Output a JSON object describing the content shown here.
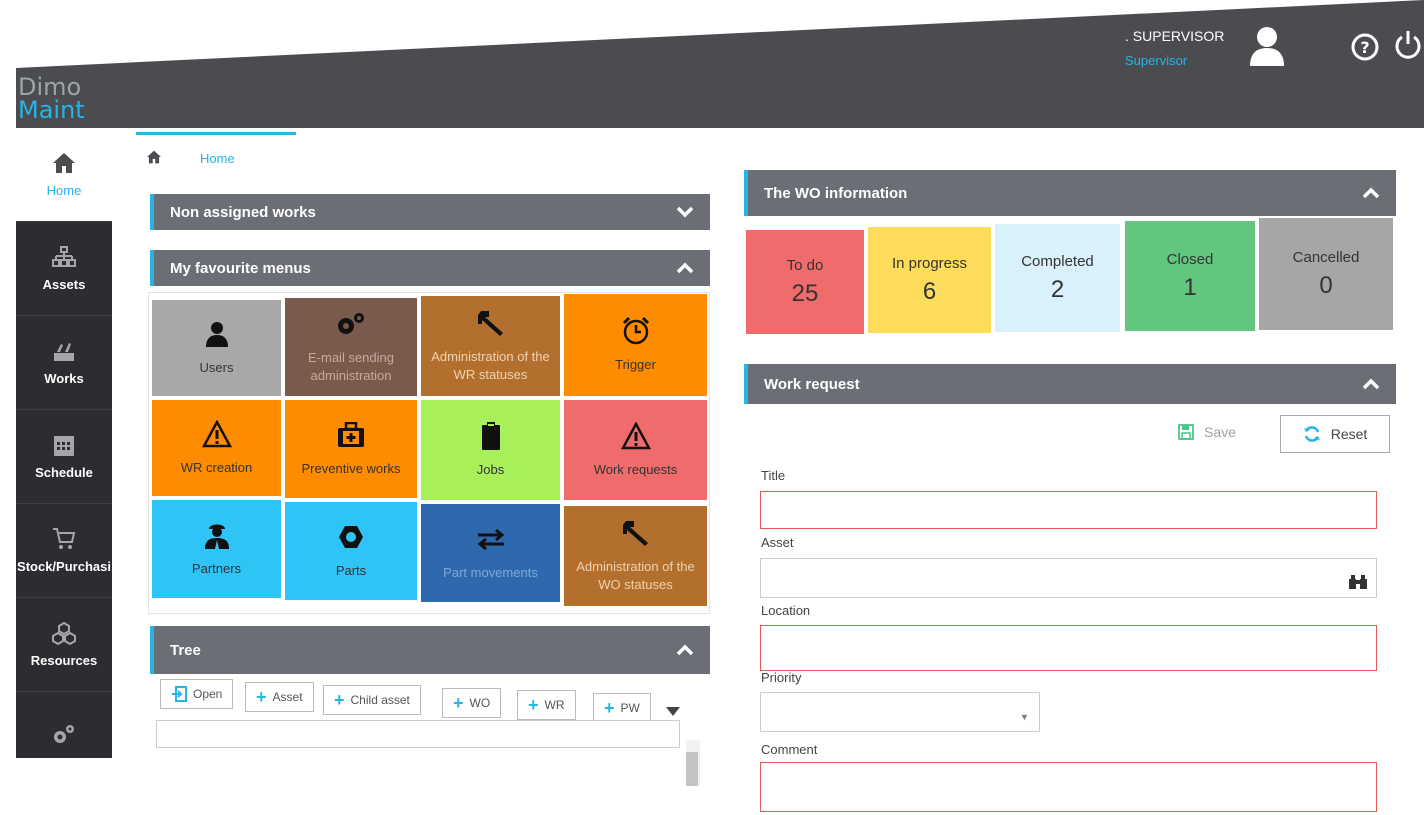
{
  "app": {
    "logo_line1": "Dimo",
    "logo_line2": "Maint"
  },
  "user": {
    "name": ". SUPERVISOR",
    "role": "Supervisor"
  },
  "sidebar": {
    "items": [
      {
        "label": "Home",
        "icon": "home-icon"
      },
      {
        "label": "Assets",
        "icon": "hierarchy-icon"
      },
      {
        "label": "Works",
        "icon": "works-icon"
      },
      {
        "label": "Schedule",
        "icon": "calendar-icon"
      },
      {
        "label": "Stock/Purchasi",
        "icon": "cart-icon"
      },
      {
        "label": "Resources",
        "icon": "cubes-icon"
      },
      {
        "label": "",
        "icon": "gears-icon"
      }
    ]
  },
  "breadcrumb": {
    "home": "Home"
  },
  "panels": {
    "non_assigned": "Non assigned works",
    "favourites": "My favourite menus",
    "tree": "Tree",
    "wo_info": "The WO information",
    "work_request": "Work request"
  },
  "tiles": [
    {
      "label": "Users",
      "color": "#a8a8a8",
      "icon": "user-icon"
    },
    {
      "label": "E-mail sending administration",
      "color": "#7a5a4c",
      "icon": "gears-icon"
    },
    {
      "label": "Administration of the WR statuses",
      "color": "#b26f2e",
      "icon": "wrench-icon"
    },
    {
      "label": "Trigger",
      "color": "#ff8c00",
      "icon": "alarm-icon"
    },
    {
      "label": "WR creation",
      "color": "#ff8c00",
      "icon": "warning-icon"
    },
    {
      "label": "Preventive works",
      "color": "#ff8c00",
      "icon": "first-aid-icon"
    },
    {
      "label": "Jobs",
      "color": "#a8f05a",
      "icon": "clipboard-icon"
    },
    {
      "label": "Work requests",
      "color": "#f06b6b",
      "icon": "warning-icon"
    },
    {
      "label": "Partners",
      "color": "#2ec4f5",
      "icon": "partner-icon"
    },
    {
      "label": "Parts",
      "color": "#2ec4f5",
      "icon": "nut-icon"
    },
    {
      "label": "Part movements",
      "color": "#2e69ad",
      "icon": "exchange-icon"
    },
    {
      "label": "Administration of the WO statuses",
      "color": "#b26f2e",
      "icon": "wrench-icon"
    }
  ],
  "tree": {
    "buttons": [
      "Open",
      "Asset",
      "Child asset",
      "WO",
      "WR",
      "PW"
    ]
  },
  "wo_info": [
    {
      "label": "To do",
      "value": "25",
      "color": "#f06b6b"
    },
    {
      "label": "In progress",
      "value": "6",
      "color": "#fcdc5a"
    },
    {
      "label": "Completed",
      "value": "2",
      "color": "#d8f1fa"
    },
    {
      "label": "Closed",
      "value": "1",
      "color": "#62c67e"
    },
    {
      "label": "Cancelled",
      "value": "0",
      "color": "#a6a6a6"
    }
  ],
  "work_request": {
    "save_label": "Save",
    "reset_label": "Reset",
    "fields": {
      "title": "Title",
      "asset": "Asset",
      "location": "Location",
      "priority": "Priority",
      "comment": "Comment"
    }
  }
}
